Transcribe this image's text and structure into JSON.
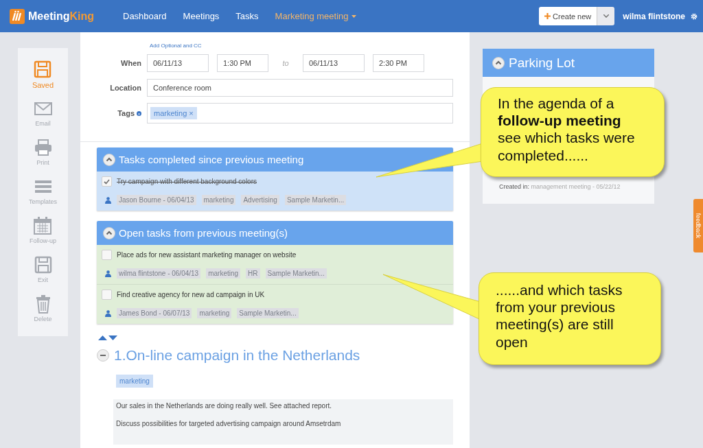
{
  "header": {
    "logo": {
      "part_1": "Meeting",
      "part_2": "King"
    },
    "nav": [
      {
        "label": "Dashboard",
        "selected": false,
        "dropdown": false
      },
      {
        "label": "Meetings",
        "selected": false,
        "dropdown": false
      },
      {
        "label": "Tasks",
        "selected": false,
        "dropdown": false
      },
      {
        "label": "Marketing meeting",
        "selected": true,
        "dropdown": true
      }
    ],
    "create_button": "Create new",
    "user": "wilma flintstone"
  },
  "sidebar": {
    "items": [
      {
        "label": "Saved",
        "selected": true
      },
      {
        "label": "Email",
        "selected": false
      },
      {
        "label": "Print",
        "selected": false
      },
      {
        "label": "Templates",
        "selected": false
      },
      {
        "label": "Follow-up",
        "selected": false
      },
      {
        "label": "Exit",
        "selected": false
      },
      {
        "label": "Delete",
        "selected": false
      }
    ]
  },
  "form": {
    "add_link": "Add Optional and CC",
    "when": {
      "label": "When",
      "start_date": "06/11/13",
      "start_time": "1:30 PM",
      "separator": "to",
      "end_date": "06/11/13",
      "end_time": "2:30 PM"
    },
    "location": {
      "label": "Location",
      "value": "Conference room"
    },
    "tags": {
      "label": "Tags",
      "chips": [
        {
          "label": "marketing",
          "remove": "×"
        }
      ]
    }
  },
  "sections": [
    {
      "title": "Tasks completed since previous meeting",
      "kind": "completed",
      "tasks": [
        {
          "title": "Try campaign with different background colors",
          "checked": true,
          "owner": "Jason Bourne - 06/04/13",
          "tags": [
            "marketing",
            "Advertising",
            "Sample Marketin..."
          ]
        }
      ]
    },
    {
      "title": "Open tasks from previous meeting(s)",
      "kind": "open",
      "tasks": [
        {
          "title": "Place ads for new assistant marketing manager on website",
          "checked": false,
          "owner": "wilma flintstone - 06/04/13",
          "tags": [
            "marketing",
            "HR",
            "Sample Marketin..."
          ]
        },
        {
          "title": "Find creative agency for new ad campaign in UK",
          "checked": false,
          "owner": "James Bond - 06/07/13",
          "tags": [
            "marketing",
            "Sample Marketin..."
          ]
        }
      ]
    }
  ],
  "agenda_item": {
    "title": "1.On-line campaign in the Netherlands",
    "tags": [
      "marketing"
    ],
    "notes": [
      "Our sales in the Netherlands are doing really well. See attached report.",
      "Discuss possibilities for targeted advertising campaign around Amsetrdam"
    ]
  },
  "parking_lot": {
    "title": "Parking Lot",
    "created_label": "Created in:",
    "created_value": "management meeting - 05/22/12"
  },
  "feedback_tab": "feedback",
  "callouts": [
    {
      "text": "In the agenda of a **follow-up meeting** see which tasks were completed......"
    },
    {
      "text": "......and which tasks from your previous meeting(s) are still open"
    }
  ]
}
